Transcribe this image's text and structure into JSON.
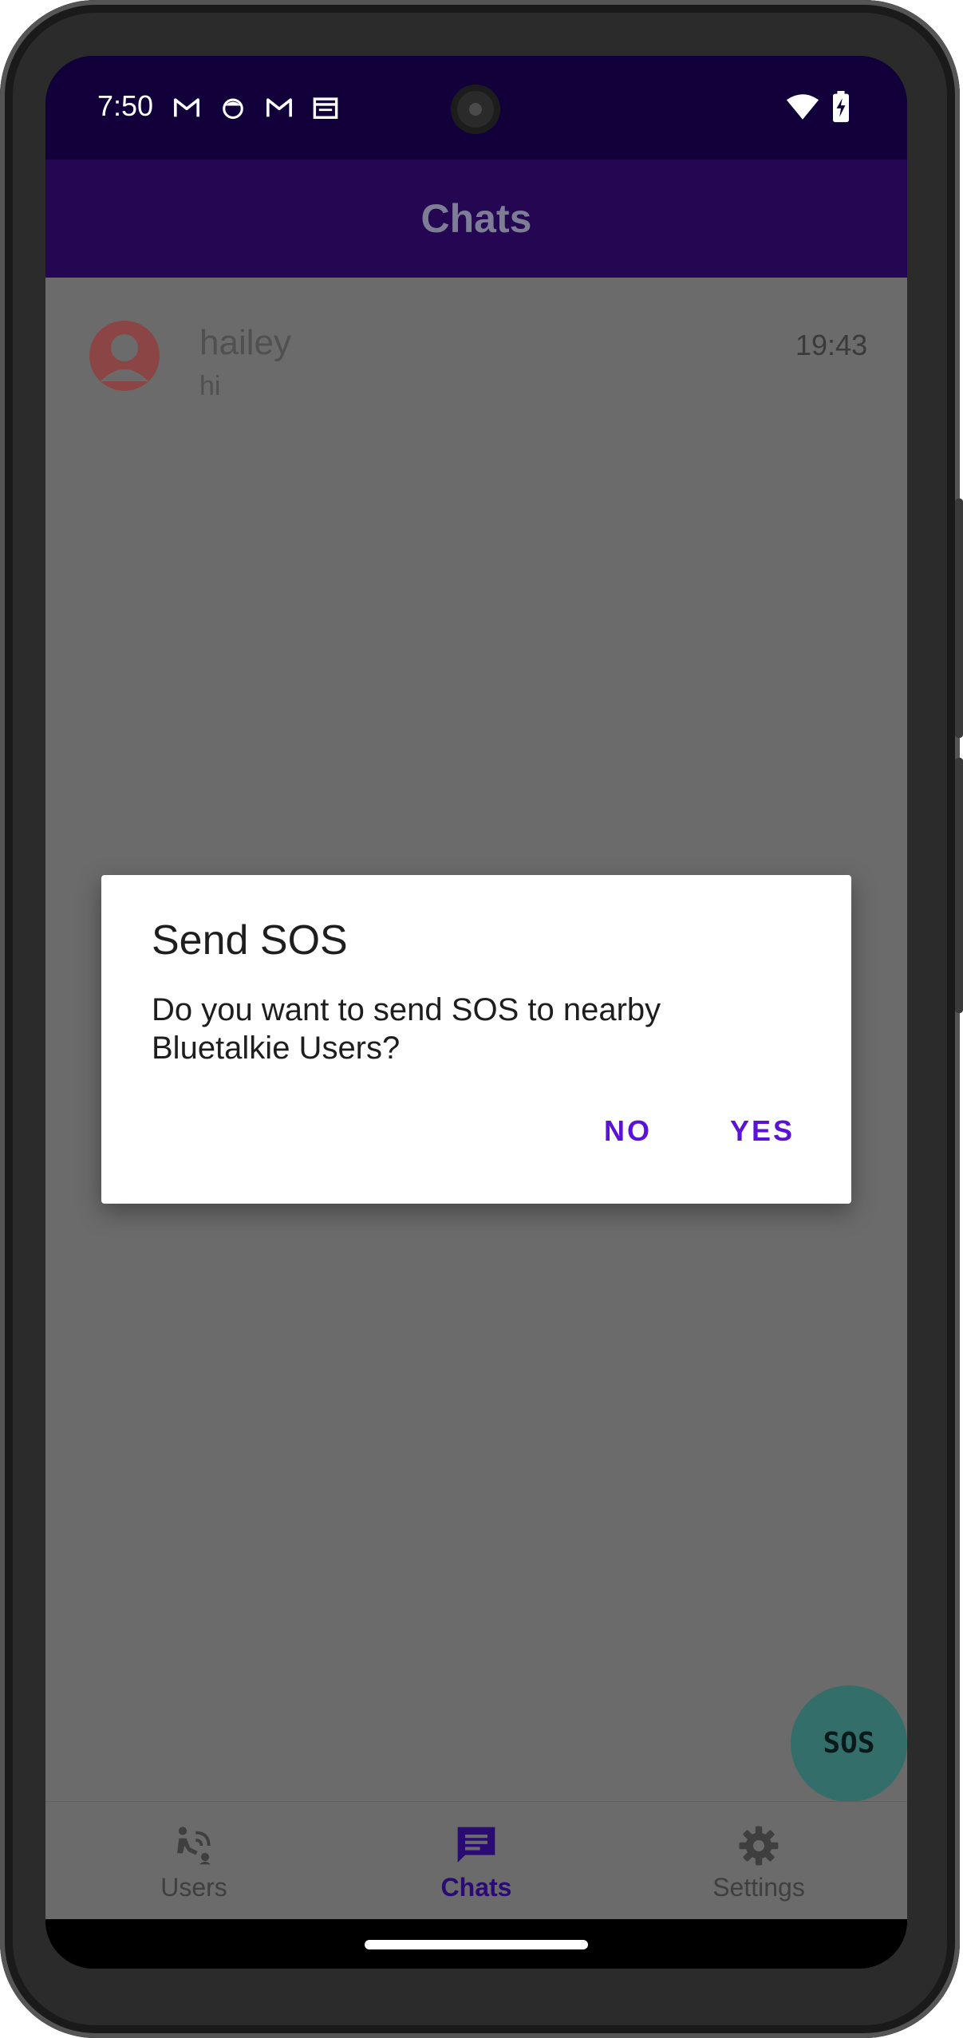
{
  "status_bar": {
    "time": "7:50",
    "notification_icons": [
      "gmail-icon",
      "face-icon",
      "gmail-icon",
      "calendar-icon"
    ],
    "right_icons": [
      "wifi-icon",
      "battery-charging-icon"
    ]
  },
  "app_bar": {
    "title": "Chats"
  },
  "chats": [
    {
      "name": "hailey",
      "last_message": "hi",
      "time": "19:43"
    }
  ],
  "dialog": {
    "title": "Send SOS",
    "message": "Do you want to send SOS to nearby Bluetalkie Users?",
    "negative_label": "NO",
    "positive_label": "YES"
  },
  "fab": {
    "label": "SOS"
  },
  "bottom_nav": {
    "items": [
      {
        "label": "Users",
        "icon": "users-nearby-icon",
        "active": false
      },
      {
        "label": "Chats",
        "icon": "chat-icon",
        "active": true
      },
      {
        "label": "Settings",
        "icon": "settings-gear-icon",
        "active": false
      }
    ]
  },
  "colors": {
    "status_bar": "#12003a",
    "app_bar": "#240652",
    "accent": "#5a13d6",
    "scrim": "#6b6b6b",
    "fab": "#336e6a"
  }
}
